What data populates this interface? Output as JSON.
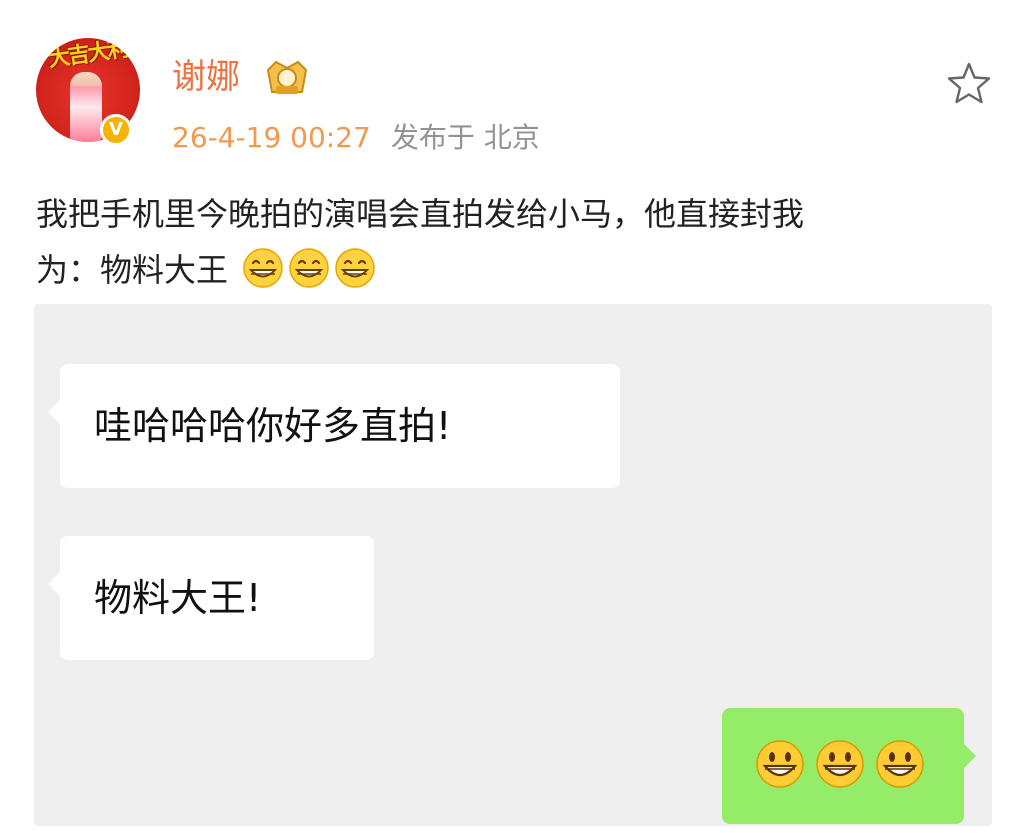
{
  "post": {
    "author": {
      "name": "谢娜",
      "avatar_icon": "avatar-icon",
      "verified_icon": "verified-badge-icon",
      "verified_mark": "V",
      "level_badge_icon": "member-level-badge-icon"
    },
    "time": "26-4-19 00:27",
    "location": "发布于 北京",
    "text_line1": "我把手机里今晚拍的演唱会直拍发给小马，他直接封我",
    "text_line2": "为：物料大王",
    "inline_emoji": [
      "grin-emoji",
      "grin-emoji",
      "grin-emoji"
    ],
    "favorite_icon": "star-icon"
  },
  "chat": {
    "messages": [
      {
        "side": "left",
        "text": "哇哈哈哈你好多直拍!"
      },
      {
        "side": "left",
        "text": "物料大王!"
      },
      {
        "side": "right",
        "emoji": [
          "smile-emoji",
          "smile-emoji",
          "smile-emoji"
        ]
      }
    ],
    "colors": {
      "background": "#efefef",
      "incoming_bubble": "#ffffff",
      "outgoing_bubble": "#95ec69"
    }
  },
  "colors": {
    "username": "#eb7340",
    "time": "#f09a50",
    "location": "#939393",
    "text": "#222222"
  }
}
